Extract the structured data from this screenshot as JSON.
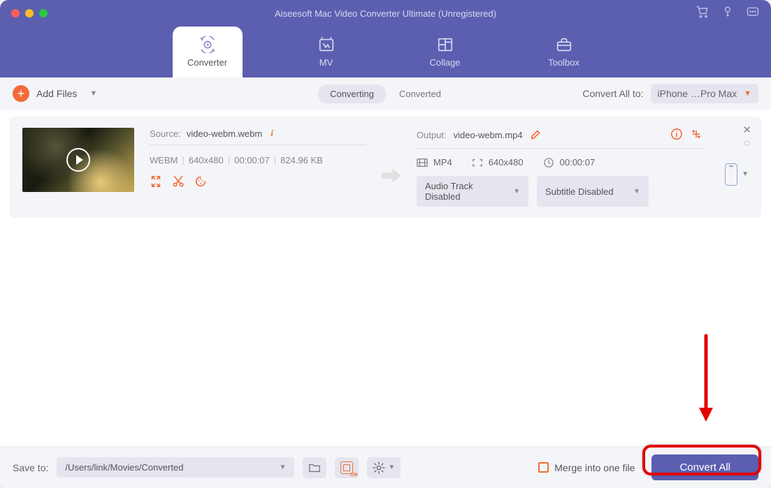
{
  "window": {
    "title": "Aiseesoft Mac Video Converter Ultimate (Unregistered)"
  },
  "nav": {
    "converter": "Converter",
    "mv": "MV",
    "collage": "Collage",
    "toolbox": "Toolbox"
  },
  "toolbar": {
    "add_files": "Add Files",
    "tab_converting": "Converting",
    "tab_converted": "Converted",
    "convert_all_label": "Convert All to:",
    "convert_all_value": "iPhone …Pro Max"
  },
  "file": {
    "source_label": "Source:",
    "source_name": "video-webm.webm",
    "meta_format": "WEBM",
    "meta_res": "640x480",
    "meta_dur": "00:00:07",
    "meta_size": "824.96 KB",
    "output_label": "Output:",
    "output_name": "video-webm.mp4",
    "out_format": "MP4",
    "out_res": "640x480",
    "out_dur": "00:00:07",
    "audio_track": "Audio Track Disabled",
    "subtitle": "Subtitle Disabled"
  },
  "footer": {
    "save_label": "Save to:",
    "save_path": "/Users/link/Movies/Converted",
    "merge_label": "Merge into one file",
    "convert_all": "Convert All"
  }
}
